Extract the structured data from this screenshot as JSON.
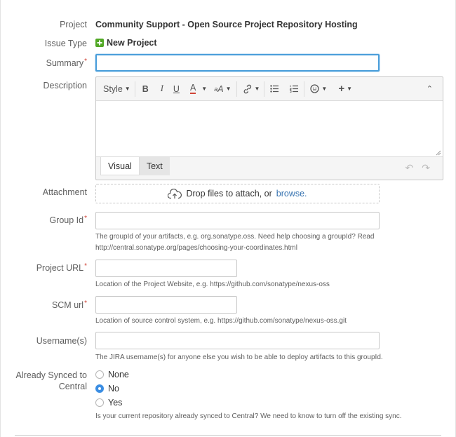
{
  "project": {
    "label": "Project",
    "value": "Community Support - Open Source Project Repository Hosting"
  },
  "issue_type": {
    "label": "Issue Type",
    "value": "New Project",
    "icon": "plus-square-icon",
    "icon_color": "#51a825"
  },
  "summary": {
    "label": "Summary",
    "value": ""
  },
  "description": {
    "label": "Description",
    "toolbar": {
      "style_label": "Style",
      "buttons": [
        "bold-icon",
        "italic-icon",
        "underline-icon",
        "text-color-icon",
        "text-format-icon",
        "link-icon",
        "bullet-list-icon",
        "numbered-list-icon",
        "emoticon-icon",
        "insert-more-icon",
        "collapse-icon"
      ]
    },
    "tab_visual": "Visual",
    "tab_text": "Text"
  },
  "attachment": {
    "label": "Attachment",
    "text": "Drop files to attach, or",
    "link": "browse."
  },
  "group_id": {
    "label": "Group Id",
    "value": "",
    "help": "The groupId of your artifacts, e.g. org.sonatype.oss. Need help choosing a groupId? Read http://central.sonatype.org/pages/choosing-your-coordinates.html"
  },
  "project_url": {
    "label": "Project URL",
    "value": "",
    "help": "Location of the Project Website, e.g. https://github.com/sonatype/nexus-oss"
  },
  "scm_url": {
    "label": "SCM url",
    "value": "",
    "help": "Location of source control system, e.g. https://github.com/sonatype/nexus-oss.git"
  },
  "usernames": {
    "label": "Username(s)",
    "value": "",
    "help": "The JIRA username(s) for anyone else you wish to be able to deploy artifacts to this groupId."
  },
  "synced": {
    "label_line1": "Already Synced to",
    "label_line2": "Central",
    "options": [
      "None",
      "No",
      "Yes"
    ],
    "selected": "No",
    "help": "Is your current repository already synced to Central? We need to know to turn off the existing sync."
  },
  "colors": {
    "required": "#d04437",
    "focus": "#4a9eda",
    "link": "#3572b0",
    "radio_selected": "#3b8ee3"
  }
}
